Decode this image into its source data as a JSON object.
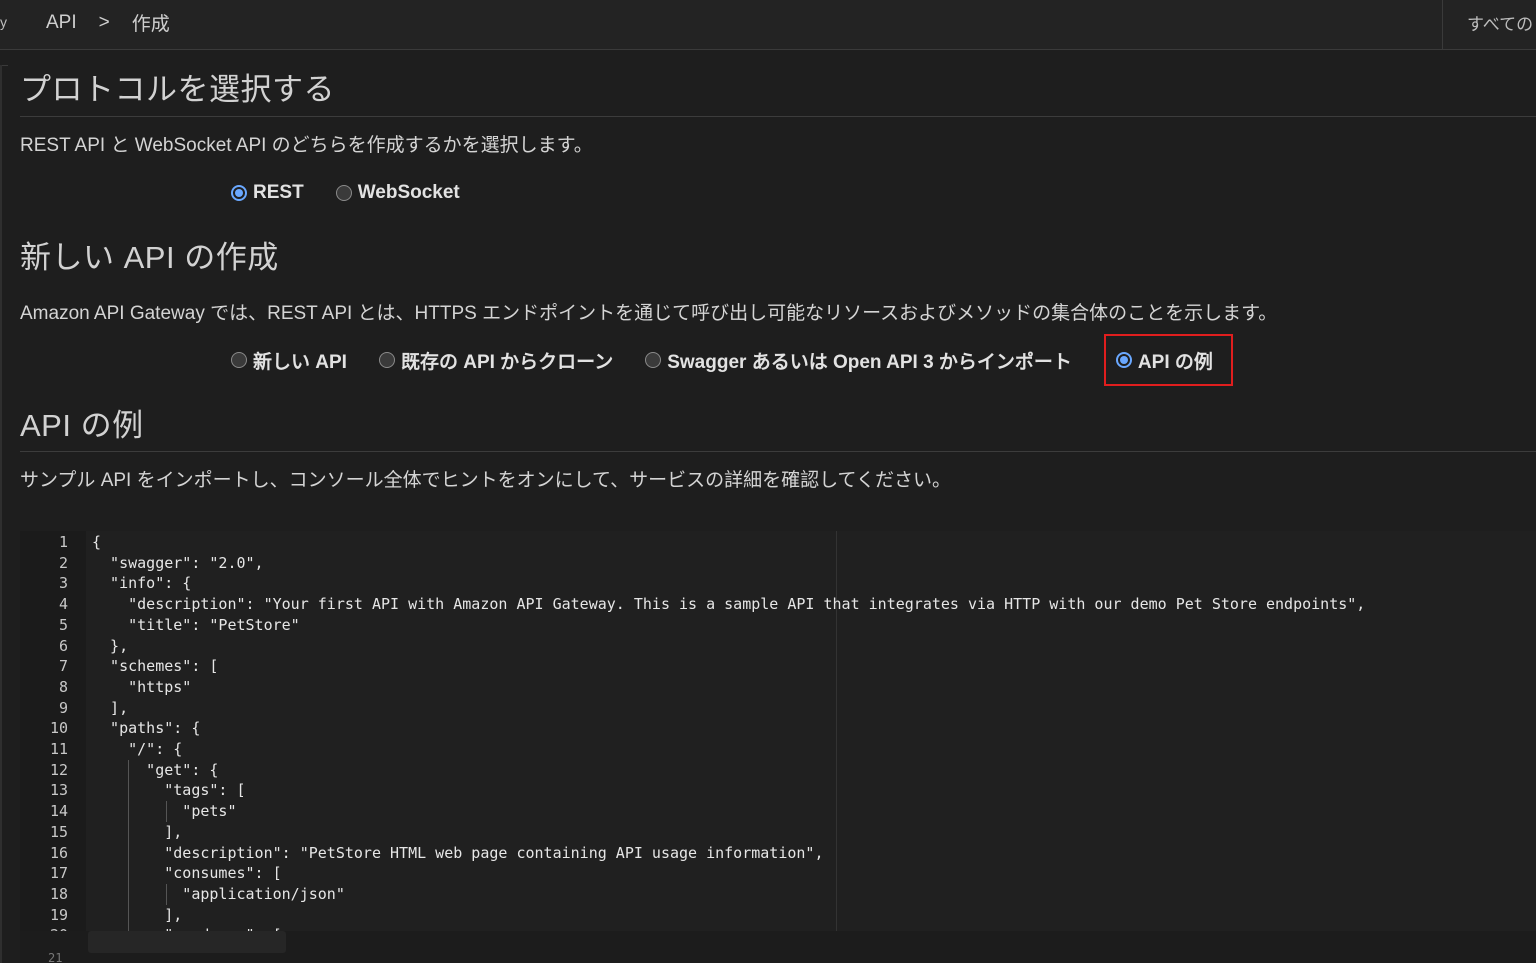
{
  "topbar": {
    "edge_glyph": "y",
    "breadcrumb": [
      "API",
      ">",
      "作成"
    ],
    "right_label": "すべての"
  },
  "protocol": {
    "title": "プロトコルを選択する",
    "description": "REST API と WebSocket API のどちらを作成するかを選択します。",
    "options": [
      {
        "label": "REST",
        "selected": true
      },
      {
        "label": "WebSocket",
        "selected": false
      }
    ]
  },
  "create": {
    "title": "新しい API の作成",
    "description": "Amazon API Gateway では、REST API とは、HTTPS エンドポイントを通じて呼び出し可能なリソースおよびメソッドの集合体のことを示します。",
    "options": [
      {
        "label": "新しい API",
        "selected": false
      },
      {
        "label": "既存の API からクローン",
        "selected": false
      },
      {
        "label": "Swagger あるいは Open API 3 からインポート",
        "selected": false
      },
      {
        "label": "API の例",
        "selected": true
      }
    ]
  },
  "example": {
    "title": "API の例",
    "description": "サンプル API をインポートし、コンソール全体でヒントをオンにして、サービスの詳細を確認してください。"
  },
  "editor": {
    "lines": [
      "{",
      "  \"swagger\": \"2.0\",",
      "  \"info\": {",
      "    \"description\": \"Your first API with Amazon API Gateway. This is a sample API that integrates via HTTP with our demo Pet Store endpoints\",",
      "    \"title\": \"PetStore\"",
      "  },",
      "  \"schemes\": [",
      "    \"https\"",
      "  ],",
      "  \"paths\": {",
      "    \"/\": {",
      "      \"get\": {",
      "        \"tags\": [",
      "          \"pets\"",
      "        ],",
      "        \"description\": \"PetStore HTML web page containing API usage information\",",
      "        \"consumes\": [",
      "          \"application/json\"",
      "        ],",
      "        \"produces\": ["
    ],
    "line_numbers": [
      "1",
      "2",
      "3",
      "4",
      "5",
      "6",
      "7",
      "8",
      "9",
      "10",
      "11",
      "12",
      "13",
      "14",
      "15",
      "16",
      "17",
      "18",
      "19",
      "20"
    ],
    "next_line_number": "21"
  }
}
